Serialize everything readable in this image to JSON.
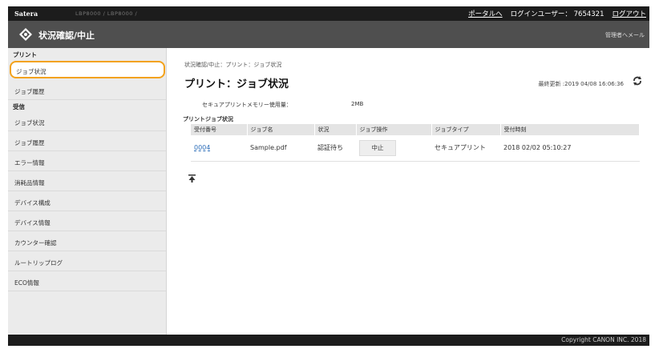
{
  "topbar": {
    "brand": "Satera",
    "device": "LBP8000 / LBP8000 /",
    "portal": "ポータルへ",
    "login_user": "ログインユーザー： 7654321",
    "logout": "ログアウト"
  },
  "titlebar": {
    "title": "状況確認/中止",
    "mail": "管理者へメール"
  },
  "sidebar": {
    "section_print": "プリント",
    "section_receive": "受信",
    "items": [
      "ジョブ状況",
      "ジョブ履歴",
      "ジョブ状況",
      "ジョブ履歴",
      "エラー情報",
      "消耗品情報",
      "デバイス構成",
      "デバイス情報",
      "カウンター確認",
      "ルートリップログ",
      "ECO情報"
    ]
  },
  "main": {
    "breadcrumb": "状況確認/中止：プリント：ジョブ状況",
    "heading": "プリント：ジョブ状況",
    "last_updated": "最終更新 :2019 04/08 16:06:36",
    "memory_label": "セキュアプリントメモリー使用量：",
    "memory_value": "2MB",
    "table_caption": "プリントジョブ状況",
    "table": {
      "headers": [
        "受付番号",
        "ジョブ名",
        "状況",
        "ジョブ操作",
        "ジョブタイプ",
        "受付時刻"
      ],
      "rows": [
        {
          "number": "0004",
          "name": "Sample.pdf",
          "status": "認証待ち",
          "action": "中止",
          "type": "セキュアプリント",
          "time": "2018 02/02 05:10:27"
        }
      ]
    }
  },
  "footer": {
    "copyright": "Copyright CANON INC. 2018"
  }
}
